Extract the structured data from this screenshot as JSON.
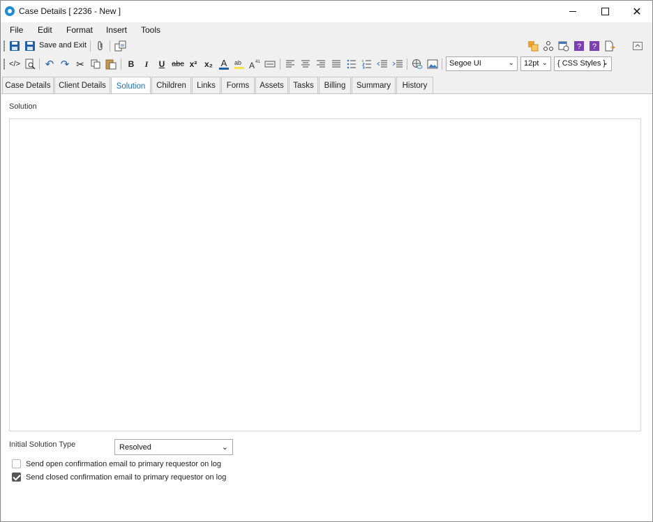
{
  "window": {
    "title": "Case Details [ 2236 - New ]"
  },
  "menu": [
    "File",
    "Edit",
    "Format",
    "Insert",
    "Tools"
  ],
  "toolbar": {
    "save_exit_label": "Save and Exit"
  },
  "format_toolbar": {
    "font_family": "Segoe UI",
    "font_size": "12pt",
    "css_styles": "{ CSS Styles }"
  },
  "tabs": [
    "Case Details",
    "Client Details",
    "Solution",
    "Children",
    "Links",
    "Forms",
    "Assets",
    "Tasks",
    "Billing",
    "Summary",
    "History"
  ],
  "active_tab": "Solution",
  "solution": {
    "label": "Solution",
    "initial_type_label": "Initial Solution Type",
    "initial_type_value": "Resolved",
    "open_email_label": "Send open confirmation email to primary requestor on log",
    "open_email_checked": false,
    "closed_email_label": "Send closed confirmation email to primary requestor on log",
    "closed_email_checked": true
  },
  "colors": {
    "accent": "#1e70b8",
    "save_icon": "#1f5fa8"
  }
}
